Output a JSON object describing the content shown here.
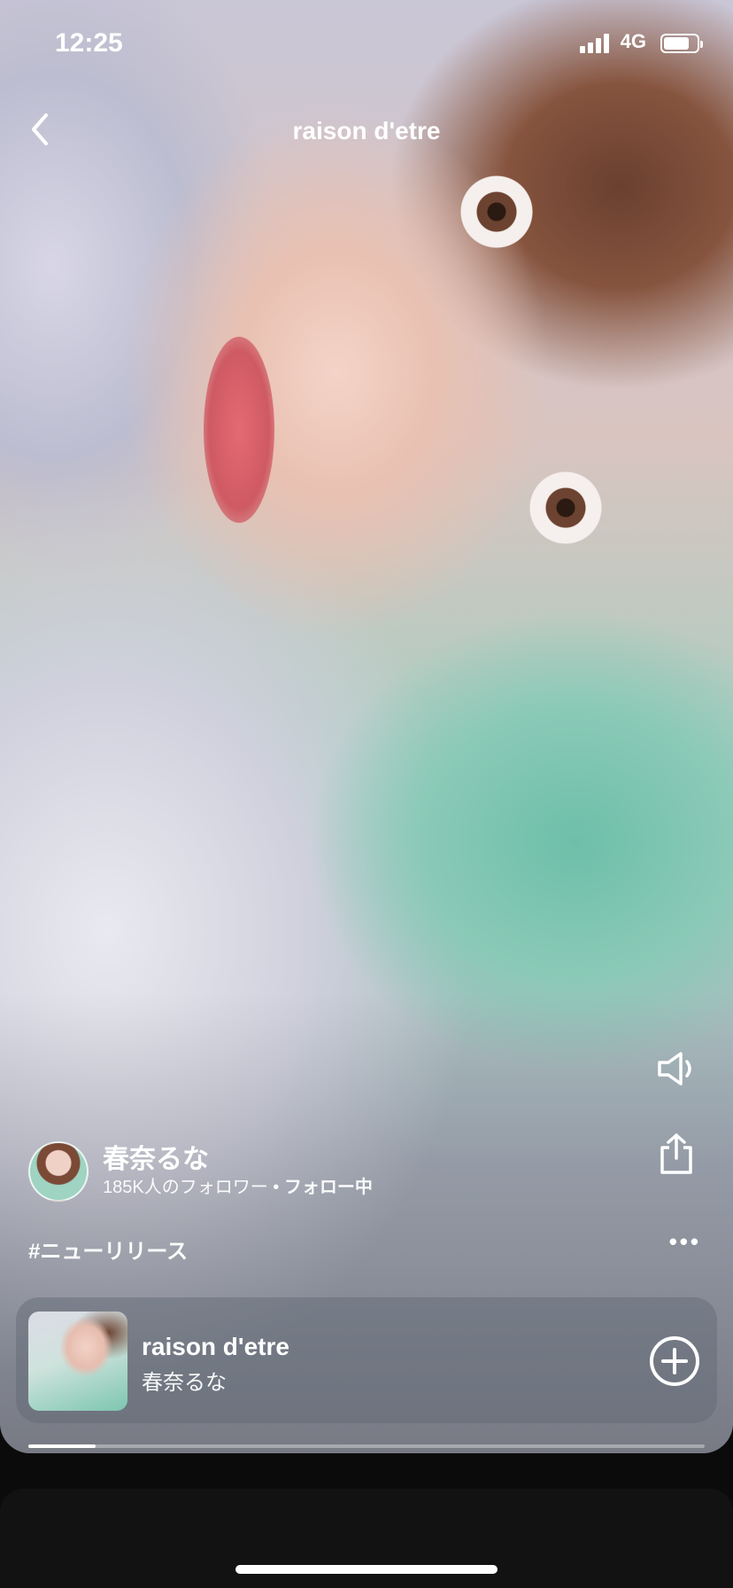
{
  "status_bar": {
    "time": "12:25",
    "network": "4G"
  },
  "header": {
    "title": "raison d'etre",
    "back_icon": "chevron-left-icon"
  },
  "side_actions": [
    {
      "icon": "speaker-icon"
    },
    {
      "icon": "share-icon"
    }
  ],
  "artist": {
    "name": "春奈るな",
    "followers": "185K人のフォロワー",
    "separator": " • ",
    "follow_status": "フォロー中"
  },
  "hashtag": "#ニューリリース",
  "more_label": "•••",
  "track": {
    "title": "raison d'etre",
    "artist": "春奈るな",
    "add_icon": "add-circle-icon"
  },
  "playback": {
    "progress": 0.1
  },
  "colors": {
    "background": "#0b0b0b",
    "text": "#ffffff"
  }
}
